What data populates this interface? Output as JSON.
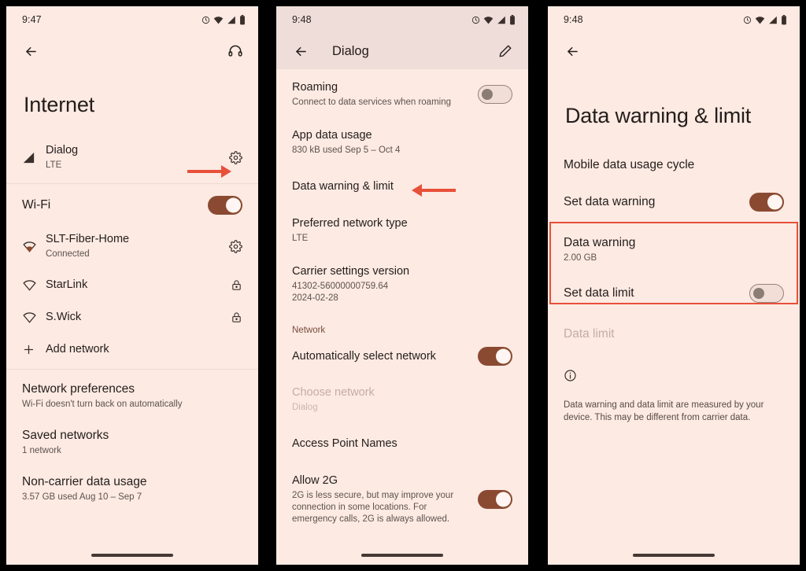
{
  "panel1": {
    "status": {
      "time": "9:47",
      "icons": [
        "alarm-icon",
        "wifi-icon",
        "signal-icon",
        "battery-icon"
      ]
    },
    "appbar": {
      "back": "back-arrow-icon",
      "action": "headset-help-icon"
    },
    "title": "Internet",
    "sim_row": {
      "title": "Dialog",
      "sub": "LTE",
      "lead_icon": "signal-bars-icon",
      "trail_icon": "gear-icon"
    },
    "wifi_toggle_row": {
      "title": "Wi-Fi",
      "state": "on"
    },
    "networks": [
      {
        "title": "SLT-Fiber-Home",
        "sub": "Connected",
        "lead_icon": "wifi-connected-icon",
        "trail_icon": "gear-icon"
      },
      {
        "title": "StarLink",
        "sub": "",
        "lead_icon": "wifi-empty-icon",
        "trail_icon": "lock-icon"
      },
      {
        "title": "S.Wick",
        "sub": "",
        "lead_icon": "wifi-empty-icon",
        "trail_icon": "lock-icon"
      }
    ],
    "add_network": {
      "title": "Add network",
      "lead_icon": "plus-icon"
    },
    "footer_rows": [
      {
        "title": "Network preferences",
        "sub": "Wi-Fi doesn't turn back on automatically"
      },
      {
        "title": "Saved networks",
        "sub": "1 network"
      },
      {
        "title": "Non-carrier data usage",
        "sub": "3.57 GB used Aug 10 – Sep 7"
      }
    ]
  },
  "panel2": {
    "status": {
      "time": "9:48",
      "icons": [
        "alarm-icon",
        "wifi-icon",
        "signal-icon",
        "battery-icon"
      ]
    },
    "appbar": {
      "back": "back-arrow-icon",
      "title": "Dialog",
      "action": "pencil-edit-icon"
    },
    "rows": [
      {
        "title": "Roaming",
        "sub": "Connect to data services when roaming",
        "switch": "off"
      },
      {
        "title": "App data usage",
        "sub": "830 kB used Sep 5 – Oct 4"
      },
      {
        "title": "Data warning & limit",
        "sub": ""
      },
      {
        "title": "Preferred network type",
        "sub": "LTE"
      },
      {
        "title": "Carrier settings version",
        "sub": "41302-56000000759.64\n2024-02-28"
      }
    ],
    "section_label": "Network",
    "rows2": [
      {
        "title": "Automatically select network",
        "sub": "",
        "switch": "on"
      },
      {
        "title": "Choose network",
        "sub": "Dialog",
        "dim": true
      },
      {
        "title": "Access Point Names",
        "sub": ""
      },
      {
        "title": "Allow 2G",
        "sub": "2G is less secure, but may improve your connection in some locations. For emergency calls, 2G is always allowed.",
        "switch": "on"
      }
    ]
  },
  "panel3": {
    "status": {
      "time": "9:48",
      "icons": [
        "alarm-icon",
        "wifi-icon",
        "signal-icon",
        "battery-icon"
      ]
    },
    "appbar": {
      "back": "back-arrow-icon"
    },
    "title": "Data warning & limit",
    "rows": [
      {
        "title": "Mobile data usage cycle",
        "sub": ""
      },
      {
        "title": "Set data warning",
        "sub": "",
        "switch": "on"
      },
      {
        "title": "Data warning",
        "sub": "2.00 GB"
      },
      {
        "title": "Set data limit",
        "sub": "",
        "switch": "off"
      },
      {
        "title": "Data limit",
        "sub": "",
        "dim": true
      }
    ],
    "info": {
      "icon": "info-circle-icon",
      "text": "Data warning and data limit are measured by your device. This may be different from carrier data."
    }
  },
  "annotations": {
    "accent_red": "#E8503A",
    "accent_brown": "#8A4A31",
    "bg": "#FCEAE3",
    "appbar_bg": "#EEDDD8"
  }
}
